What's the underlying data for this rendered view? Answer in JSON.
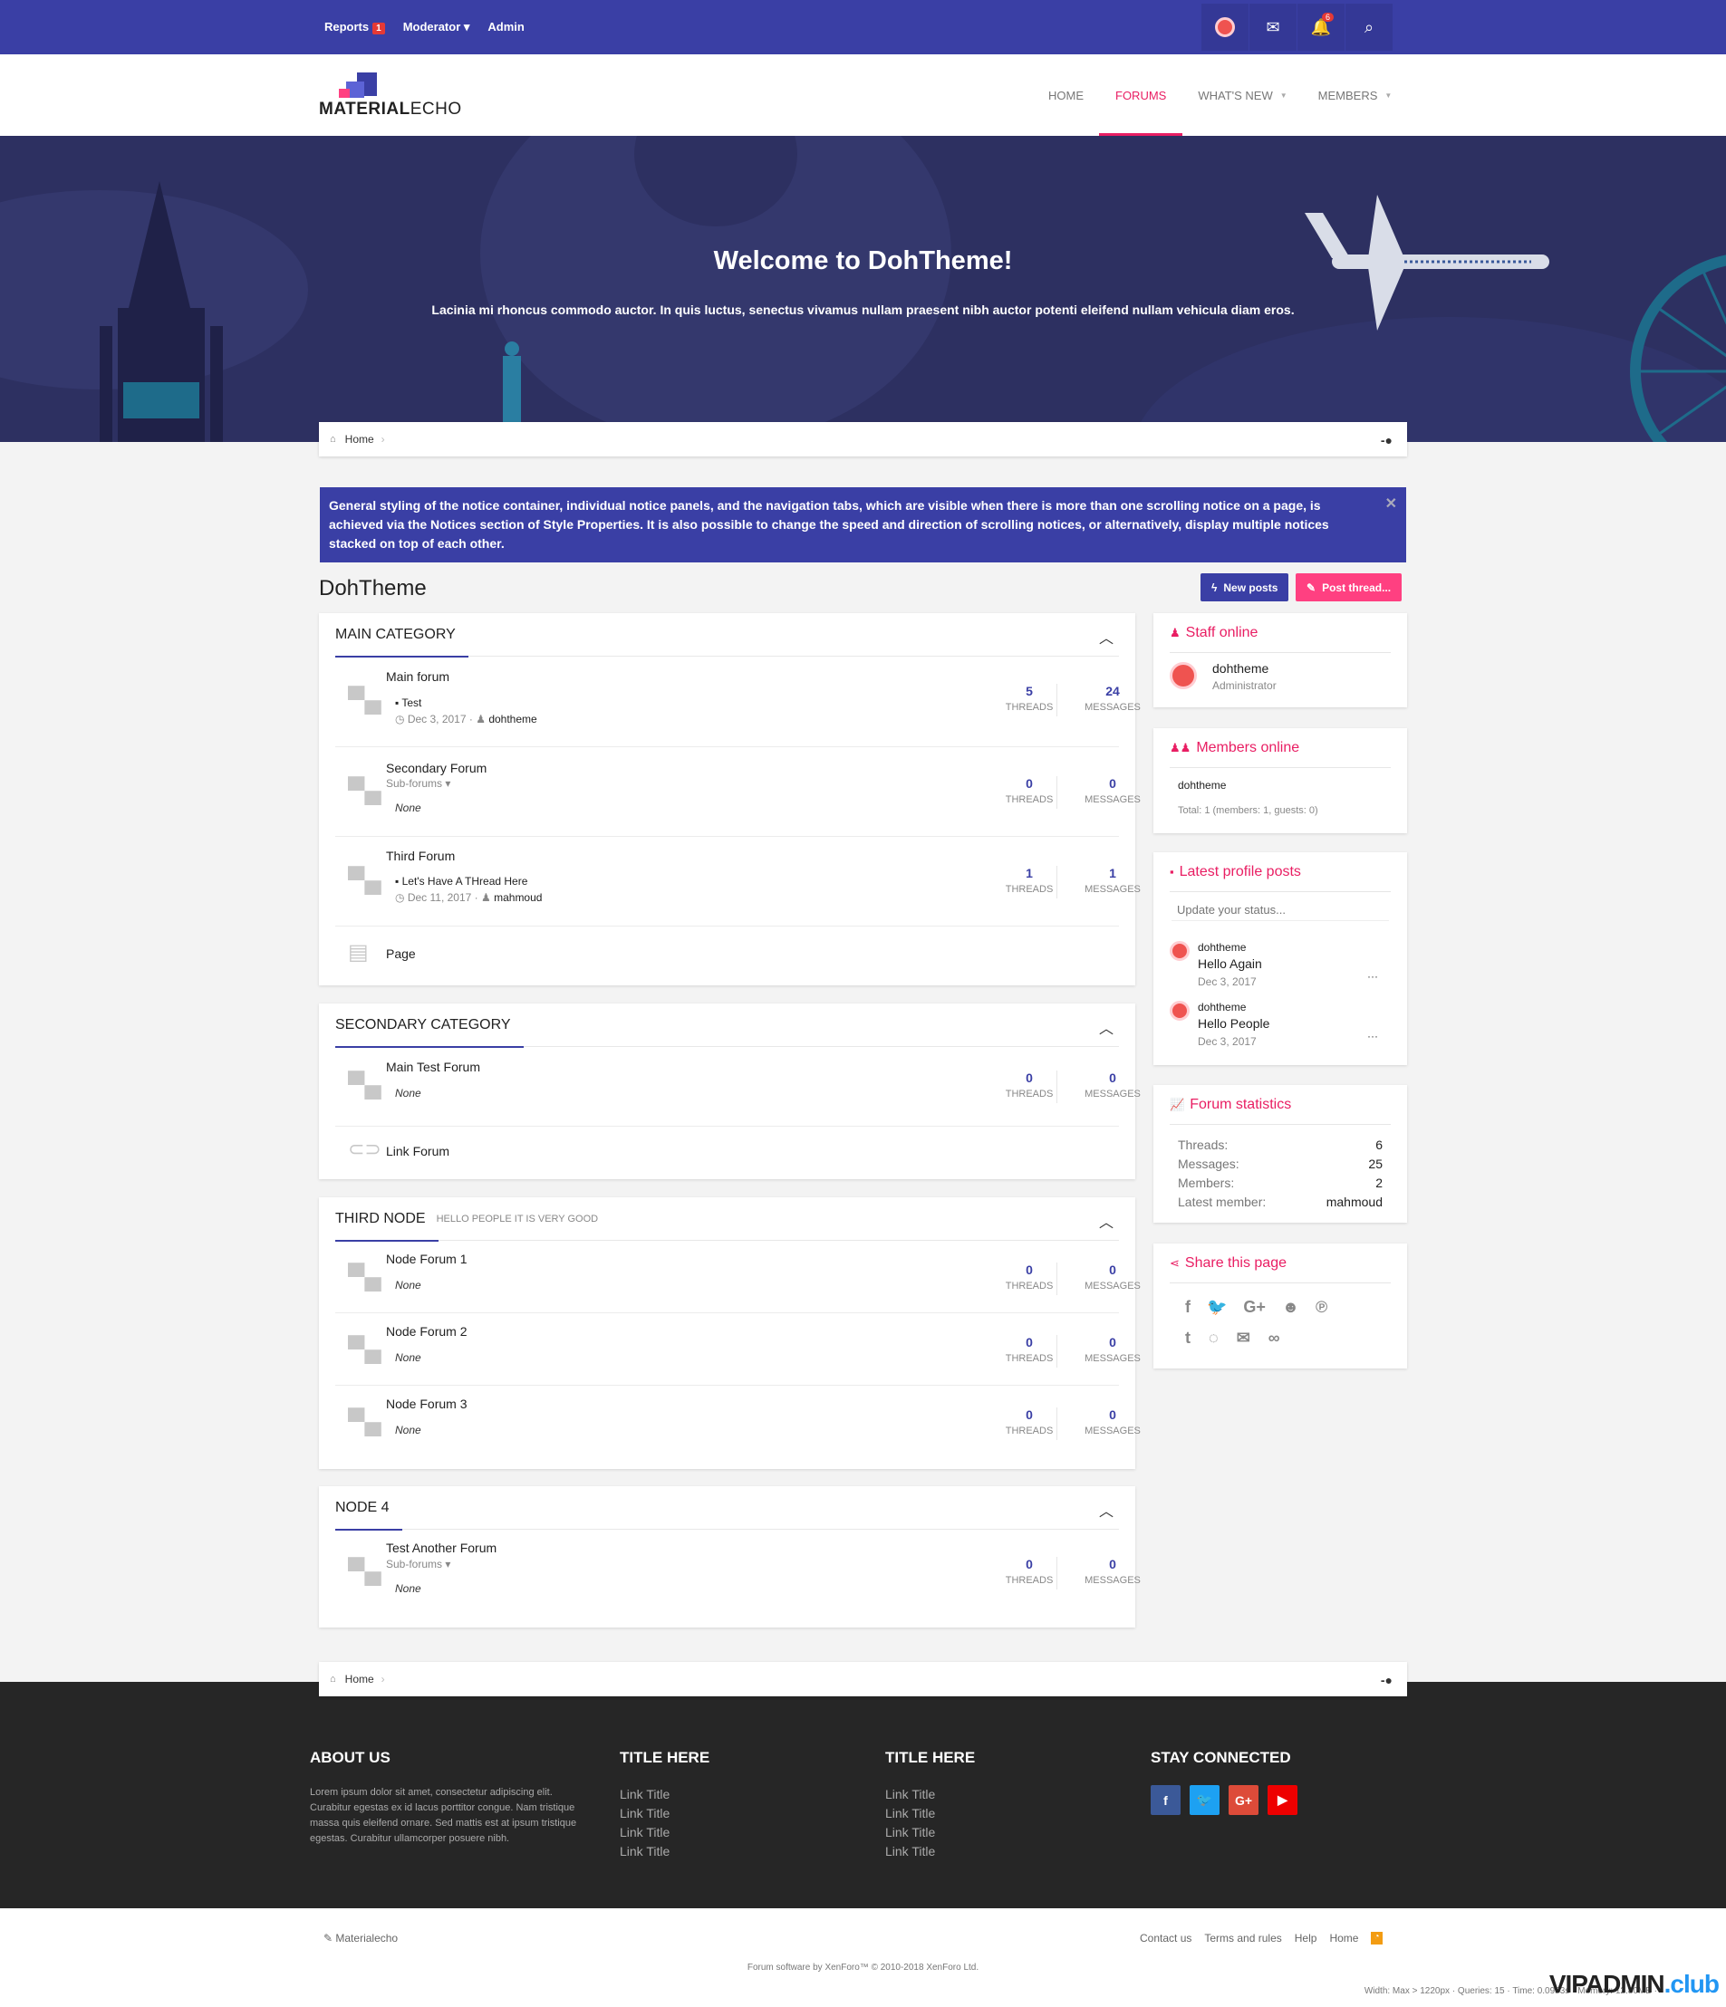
{
  "topbar": {
    "reports": "Reports",
    "reports_count": "1",
    "moderator": "Moderator",
    "admin": "Admin",
    "alerts_count": "6"
  },
  "logo": {
    "main": "MATERIAL",
    "accent": "ECHO"
  },
  "nav": {
    "home": "HOME",
    "forums": "FORUMS",
    "whats_new": "WHAT'S NEW",
    "members": "MEMBERS"
  },
  "hero": {
    "title": "Welcome to DohTheme!",
    "subtitle": "Lacinia mi rhoncus commodo auctor. In quis luctus, senectus vivamus nullam praesent nibh auctor potenti eleifend nullam vehicula diam eros."
  },
  "breadcrumb": {
    "home": "Home"
  },
  "notice": "General styling of the notice container, individual notice panels, and the navigation tabs, which are visible when there is more than one scrolling notice on a page, is achieved via the Notices section of Style Properties. It is also possible to change the speed and direction of scrolling notices, or alternatively, display multiple notices stacked on top of each other.",
  "page_title": "DohTheme",
  "buttons": {
    "new_posts": "New posts",
    "post_thread": "Post thread..."
  },
  "labels": {
    "threads": "THREADS",
    "messages": "MESSAGES",
    "subforums": "Sub-forums",
    "none": "None"
  },
  "categories": [
    {
      "title": "MAIN CATEGORY",
      "nodes": [
        {
          "name": "Main forum",
          "latest": "Test",
          "date": "Dec 3, 2017",
          "user": "dohtheme",
          "threads": "5",
          "messages": "24"
        },
        {
          "name": "Secondary Forum",
          "threads": "0",
          "messages": "0"
        },
        {
          "name": "Third Forum",
          "latest": "Let's Have A THread Here",
          "date": "Dec 11, 2017",
          "user": "mahmoud",
          "threads": "1",
          "messages": "1"
        },
        {
          "name": "Page"
        }
      ]
    },
    {
      "title": "SECONDARY CATEGORY",
      "nodes": [
        {
          "name": "Main Test Forum",
          "threads": "0",
          "messages": "0"
        },
        {
          "name": "Link Forum"
        }
      ]
    },
    {
      "title": "THIRD NODE",
      "subtitle": "HELLO PEOPLE IT IS VERY GOOD",
      "nodes": [
        {
          "name": "Node Forum 1",
          "threads": "0",
          "messages": "0"
        },
        {
          "name": "Node Forum 2",
          "threads": "0",
          "messages": "0"
        },
        {
          "name": "Node Forum 3",
          "threads": "0",
          "messages": "0"
        }
      ]
    },
    {
      "title": "NODE 4",
      "nodes": [
        {
          "name": "Test Another Forum",
          "threads": "0",
          "messages": "0"
        }
      ]
    }
  ],
  "sidebar": {
    "staff": {
      "title": "Staff online",
      "name": "dohtheme",
      "role": "Administrator"
    },
    "members": {
      "title": "Members online",
      "name": "dohtheme",
      "total": "Total: 1 (members: 1, guests: 0)"
    },
    "profile_posts": {
      "title": "Latest profile posts",
      "placeholder": "Update your status...",
      "posts": [
        {
          "user": "dohtheme",
          "text": "Hello Again",
          "date": "Dec 3, 2017"
        },
        {
          "user": "dohtheme",
          "text": "Hello People",
          "date": "Dec 3, 2017"
        }
      ]
    },
    "stats": {
      "title": "Forum statistics",
      "threads_label": "Threads:",
      "threads": "6",
      "messages_label": "Messages:",
      "messages": "25",
      "members_label": "Members:",
      "members": "2",
      "latest_label": "Latest member:",
      "latest": "mahmoud"
    },
    "share": {
      "title": "Share this page"
    }
  },
  "footer": {
    "about_title": "ABOUT US",
    "about_text": "Lorem ipsum dolor sit amet, consectetur adipiscing elit. Curabitur egestas ex id lacus porttitor congue. Nam tristique massa quis eleifend ornare. Sed mattis est at ipsum tristique egestas. Curabitur ullamcorper posuere nibh.",
    "col2_title": "TITLE HERE",
    "col3_title": "TITLE HERE",
    "link": "Link Title",
    "connect_title": "STAY CONNECTED"
  },
  "bottom": {
    "style": "Materialecho",
    "contact": "Contact us",
    "terms": "Terms and rules",
    "help": "Help",
    "home": "Home",
    "copyright": "Forum software by XenForo™ © 2010-2018 XenForo Ltd.",
    "debug": "Width: Max > 1220px · Queries: 15 · Time: 0.0953s · Memory: 12.80MB ·",
    "watermark_a": "VIPADMIN",
    "watermark_b": ".club"
  },
  "colors": {
    "primary": "#3a3fa5",
    "accent": "#e91e63",
    "hero": "#2d3061",
    "footer": "#262626"
  }
}
